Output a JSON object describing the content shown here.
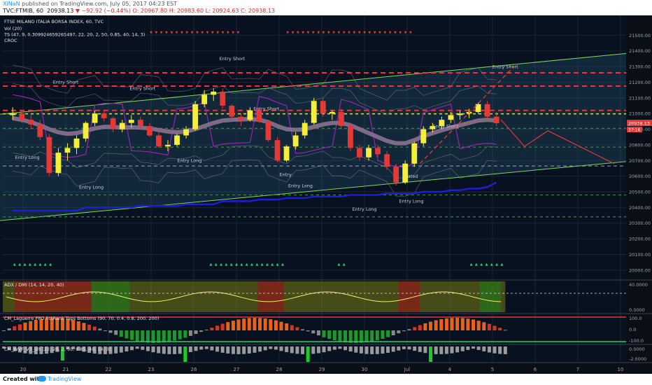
{
  "header": {
    "author": "XiNaN",
    "published": "published on TradingView.com, July 05, 2017 04:23 EST",
    "symbol": "TVC:FTMIB, 60",
    "last": "20938.13",
    "change": "▼ −92.92 (−0.44%)",
    "ohlc": "O: 20967.80  H: 20983.60  L: 20924.63  C: 20938.13"
  },
  "footer": {
    "created": "Created with",
    "brand": "TradingView"
  },
  "colors": {
    "bg": "#07111f",
    "up": "#f4f03a",
    "down": "#e53935",
    "grid": "#1c2630",
    "entry": "#e8353f",
    "sup": "#2e8a36",
    "yellow_line": "#d6e050",
    "violet": "#8e24aa",
    "blue": "#1e1ed2",
    "channel": "#7ed957",
    "fill": "rgba(40,80,110,0.35)"
  },
  "chart_data": {
    "type": "line",
    "title": "FTSE MILANO ITALIA BORSA INDEX, 60, TVC",
    "indicator_legends": [
      "Vol (20)",
      "TS (47, 9, 0.309924659265497, 22, 20, 2, 50, 0.85, 40, 14, 3)",
      "CROC"
    ],
    "x_tick_labels": [
      "20",
      "21",
      "22",
      "23",
      "26",
      "27",
      "28",
      "29",
      "30",
      "Jul",
      "4",
      "5",
      "6",
      "7",
      "10"
    ],
    "ylim": [
      19950,
      21600
    ],
    "y_ticks": [
      20000,
      20100,
      20200,
      20300,
      20400,
      20500,
      20600,
      20700,
      20800,
      20900,
      21000,
      21100,
      21200,
      21300,
      21400,
      21500
    ],
    "last_price_label": "20938.13",
    "countdown_label": "37:16",
    "horizontal_levels": [
      {
        "name": "entry-short-1",
        "value": 21260,
        "style": "red-dash"
      },
      {
        "name": "entry-short-2",
        "value": 21175,
        "style": "red-dash"
      },
      {
        "name": "entry-short-3",
        "value": 21020,
        "style": "red-dash"
      },
      {
        "name": "yellow-level",
        "value": 20998,
        "style": "yellow-dash"
      },
      {
        "name": "green-1",
        "value": 20905,
        "style": "green-dash"
      },
      {
        "name": "green-2",
        "value": 20785,
        "style": "green-dash"
      },
      {
        "name": "grey-1",
        "value": 20665,
        "style": "grey-dash"
      },
      {
        "name": "green-3",
        "value": 20480,
        "style": "green-dash"
      },
      {
        "name": "green-4",
        "value": 20340,
        "style": "green-dash"
      }
    ],
    "annotations": [
      {
        "text": "Entry Short",
        "x": 1.0,
        "y": 21190
      },
      {
        "text": "Entry Short",
        "x": 2.8,
        "y": 21150
      },
      {
        "text": "Entry Short",
        "x": 4.9,
        "y": 21340
      },
      {
        "text": "Entry Short",
        "x": 5.7,
        "y": 21020
      },
      {
        "text": "Entry Short",
        "x": 9.9,
        "y": 20910
      },
      {
        "text": "Entry Short",
        "x": 11.3,
        "y": 21290
      },
      {
        "text": "Entry Long",
        "x": 0.1,
        "y": 20710
      },
      {
        "text": "Entry Long",
        "x": 1.6,
        "y": 20520
      },
      {
        "text": "Entry Long",
        "x": 3.9,
        "y": 20690
      },
      {
        "text": "Entry Long",
        "x": 6.5,
        "y": 20530
      },
      {
        "text": "Entry Long",
        "x": 8.0,
        "y": 20380
      },
      {
        "text": "Entry Long",
        "x": 9.1,
        "y": 20430
      },
      {
        "text": "Entry",
        "x": 6.15,
        "y": 20600
      },
      {
        "text": "Lated",
        "x": 9.1,
        "y": 20590
      }
    ],
    "series": [
      {
        "name": "price",
        "candles": [
          [
            20990,
            21040,
            20960,
            21000
          ],
          [
            21000,
            21020,
            20940,
            20960
          ],
          [
            20960,
            20990,
            20900,
            20930
          ],
          [
            20930,
            20960,
            20830,
            20850
          ],
          [
            20850,
            20870,
            20600,
            20620
          ],
          [
            20620,
            20780,
            20600,
            20750
          ],
          [
            20750,
            20810,
            20700,
            20780
          ],
          [
            20780,
            20860,
            20740,
            20840
          ],
          [
            20840,
            20950,
            20820,
            20940
          ],
          [
            20940,
            21020,
            20920,
            21000
          ],
          [
            21000,
            21020,
            20950,
            20970
          ],
          [
            20970,
            20980,
            20880,
            20900
          ],
          [
            20900,
            20960,
            20880,
            20940
          ],
          [
            20940,
            20990,
            20910,
            20960
          ],
          [
            20960,
            20980,
            20900,
            20920
          ],
          [
            20920,
            20940,
            20850,
            20860
          ],
          [
            20860,
            20900,
            20780,
            20790
          ],
          [
            20790,
            20830,
            20760,
            20800
          ],
          [
            20800,
            20870,
            20790,
            20860
          ],
          [
            20860,
            20920,
            20840,
            20900
          ],
          [
            20900,
            21080,
            20890,
            21060
          ],
          [
            21060,
            21150,
            21040,
            21120
          ],
          [
            21120,
            21160,
            21080,
            21140
          ],
          [
            21140,
            21160,
            21030,
            21050
          ],
          [
            21050,
            21060,
            20950,
            20980
          ],
          [
            20980,
            21000,
            20920,
            20960
          ],
          [
            20960,
            21040,
            20950,
            21020
          ],
          [
            21020,
            21030,
            20940,
            20950
          ],
          [
            20950,
            20960,
            20820,
            20830
          ],
          [
            20830,
            20850,
            20690,
            20700
          ],
          [
            20700,
            20800,
            20690,
            20790
          ],
          [
            20790,
            20880,
            20770,
            20860
          ],
          [
            20860,
            20960,
            20840,
            20940
          ],
          [
            20940,
            21100,
            20930,
            21080
          ],
          [
            21080,
            21100,
            20980,
            21000
          ],
          [
            21000,
            21020,
            20960,
            21010
          ],
          [
            21010,
            21030,
            20900,
            20920
          ],
          [
            20920,
            20940,
            20760,
            20780
          ],
          [
            20780,
            20800,
            20700,
            20720
          ],
          [
            20720,
            20800,
            20700,
            20780
          ],
          [
            20780,
            20800,
            20720,
            20740
          ],
          [
            20740,
            20760,
            20640,
            20660
          ],
          [
            20660,
            20680,
            20540,
            20560
          ],
          [
            20560,
            20700,
            20550,
            20680
          ],
          [
            20680,
            20820,
            20660,
            20810
          ],
          [
            20810,
            20920,
            20790,
            20900
          ],
          [
            20900,
            20940,
            20880,
            20920
          ],
          [
            20920,
            20980,
            20900,
            20960
          ],
          [
            20960,
            21010,
            20940,
            20990
          ],
          [
            20990,
            21020,
            20960,
            21000
          ],
          [
            21000,
            21030,
            20970,
            21010
          ],
          [
            21010,
            21070,
            21000,
            21060
          ],
          [
            21060,
            21080,
            20960,
            20980
          ],
          [
            20980,
            21010,
            20920,
            20938.13
          ]
        ]
      },
      {
        "name": "average",
        "values": [
          20970,
          20960,
          20945,
          20925,
          20900,
          20880,
          20870,
          20875,
          20890,
          20905,
          20915,
          20915,
          20910,
          20912,
          20910,
          20905,
          20895,
          20885,
          20880,
          20885,
          20900,
          20920,
          20940,
          20955,
          20960,
          20962,
          20965,
          20960,
          20945,
          20920,
          20900,
          20895,
          20900,
          20915,
          20930,
          20940,
          20940,
          20925,
          20900,
          20875,
          20850,
          20825,
          20810,
          20810,
          20830,
          20855,
          20875,
          20893,
          20910,
          20925,
          20940,
          20955,
          20960,
          20955
        ]
      },
      {
        "name": "blue-line",
        "values": [
          20380,
          20380,
          20380,
          20380,
          20380,
          20380,
          20380,
          20380,
          20400,
          20400,
          20400,
          20400,
          20400,
          20400,
          20410,
          20410,
          20410,
          20410,
          20410,
          20420,
          20420,
          20420,
          20420,
          20440,
          20440,
          20440,
          20440,
          20450,
          20450,
          20450,
          20460,
          20460,
          20460,
          20470,
          20470,
          20470,
          20470,
          20480,
          20480,
          20480,
          20480,
          20490,
          20490,
          20490,
          20490,
          20500,
          20500,
          20500,
          20510,
          20510,
          20520,
          20520,
          20530,
          20560
        ]
      },
      {
        "name": "channel-upper",
        "endpoints": [
          [
            0,
            21010
          ],
          [
            14.0,
            21380
          ]
        ]
      },
      {
        "name": "channel-lower",
        "endpoints": [
          [
            0,
            20330
          ],
          [
            14.0,
            20690
          ]
        ]
      }
    ],
    "sub_panels": [
      {
        "title": "ADX / DMI (14, 14, 20, 40)",
        "y_ticks": [
          "40.0000",
          "0.0000"
        ]
      },
      {
        "title": "CM_Laguerre PPO PctRank Tops Bottoms (90, 70, 0.4, 0.8, 200, 200)",
        "y_ticks": [
          "100.0",
          "0.0",
          "-100.0"
        ]
      },
      {
        "title": "CM_WVF_V3_Ult (22, 20, 2, 50, 0.85, 40, 14, 3)",
        "y_ticks": [
          "0.0000",
          "-2.0000"
        ]
      }
    ]
  }
}
